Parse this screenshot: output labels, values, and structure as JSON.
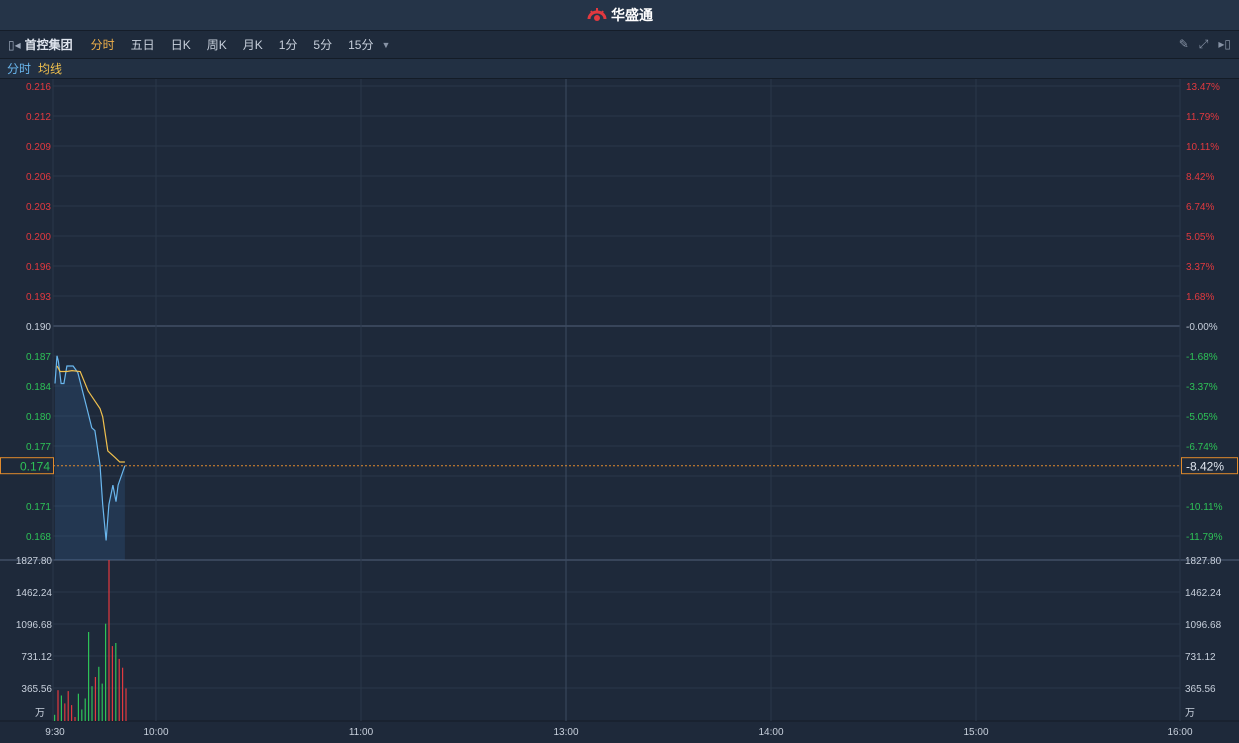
{
  "app": {
    "logo_text": "华盛通"
  },
  "toolbar": {
    "stock_name": "首控集团",
    "periods": [
      {
        "label": "分时",
        "active": true
      },
      {
        "label": "五日"
      },
      {
        "label": "日K"
      },
      {
        "label": "周K"
      },
      {
        "label": "月K"
      },
      {
        "label": "1分"
      },
      {
        "label": "5分"
      },
      {
        "label": "15分"
      }
    ]
  },
  "legend": {
    "price_label": "分时",
    "avg_label": "均线"
  },
  "colors": {
    "up": "#e2393f",
    "down": "#2ec257",
    "price_line": "#6ab7ee",
    "avg_line": "#f0c04e",
    "current": "#e08a2c"
  },
  "chart_data": {
    "type": "line",
    "prev_close": 0.19,
    "current_price": "0.174",
    "current_pct": "-8.42%",
    "price_axis": [
      "0.216",
      "0.212",
      "0.209",
      "0.206",
      "0.203",
      "0.200",
      "0.196",
      "0.193",
      "0.190",
      "0.187",
      "0.184",
      "0.180",
      "0.177",
      "0.174",
      "0.171",
      "0.168"
    ],
    "pct_axis": [
      "13.47%",
      "11.79%",
      "10.11%",
      "8.42%",
      "6.74%",
      "5.05%",
      "3.37%",
      "1.68%",
      "-0.00%",
      "-1.68%",
      "-3.37%",
      "-5.05%",
      "-6.74%",
      "-8.42%",
      "-10.11%",
      "-11.79%"
    ],
    "volume_axis": [
      "1827.80",
      "1462.24",
      "1096.68",
      "731.12",
      "365.56"
    ],
    "volume_unit": "万",
    "volume_max": 1827.8,
    "time_labels": [
      "9:30",
      "10:00",
      "11:00",
      "13:00",
      "14:00",
      "15:00",
      "16:00"
    ],
    "price_series": [
      [
        0,
        0.1829
      ],
      [
        0.6,
        0.1859
      ],
      [
        1,
        0.1853
      ],
      [
        1.8,
        0.1829
      ],
      [
        2.6,
        0.1829
      ],
      [
        3.5,
        0.1848
      ],
      [
        5.3,
        0.1848
      ],
      [
        6.7,
        0.1841
      ],
      [
        9.4,
        0.1802
      ],
      [
        10.8,
        0.1781
      ],
      [
        11.7,
        0.1778
      ],
      [
        13.2,
        0.1741
      ],
      [
        14,
        0.1698
      ],
      [
        15,
        0.1659
      ],
      [
        15.8,
        0.1698
      ],
      [
        17,
        0.1719
      ],
      [
        17.9,
        0.1701
      ],
      [
        18.5,
        0.1719
      ],
      [
        20.5,
        0.174
      ]
    ],
    "avg_series": [
      [
        0.6,
        0.1848
      ],
      [
        1.5,
        0.1842
      ],
      [
        3.5,
        0.1842
      ],
      [
        5,
        0.1843
      ],
      [
        7.4,
        0.1842
      ],
      [
        9.7,
        0.1821
      ],
      [
        13.2,
        0.1802
      ],
      [
        14,
        0.1793
      ],
      [
        15.5,
        0.1756
      ],
      [
        17.6,
        0.1749
      ],
      [
        19,
        0.1744
      ],
      [
        20.5,
        0.1744
      ]
    ],
    "volumes": [
      [
        70,
        "down"
      ],
      [
        350,
        "up"
      ],
      [
        290,
        "down"
      ],
      [
        200,
        "up"
      ],
      [
        340,
        "up"
      ],
      [
        180,
        "up"
      ],
      [
        45,
        "up"
      ],
      [
        310,
        "down"
      ],
      [
        130,
        "down"
      ],
      [
        255,
        "down"
      ],
      [
        1010,
        "down"
      ],
      [
        395,
        "down"
      ],
      [
        500,
        "up"
      ],
      [
        615,
        "down"
      ],
      [
        425,
        "down"
      ],
      [
        1105,
        "down"
      ],
      [
        1827.8,
        "up"
      ],
      [
        850,
        "up"
      ],
      [
        885,
        "down"
      ],
      [
        705,
        "up"
      ],
      [
        605,
        "up"
      ],
      [
        370,
        "up"
      ]
    ]
  }
}
